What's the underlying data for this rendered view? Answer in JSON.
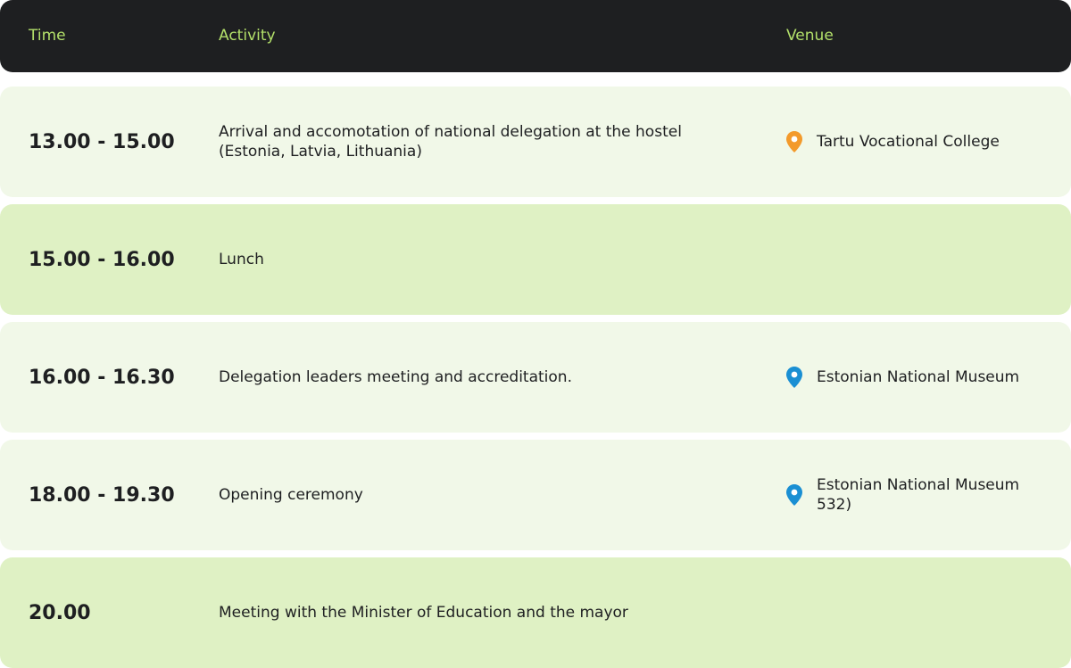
{
  "header": {
    "time": "Time",
    "activity": "Activity",
    "venue": "Venue"
  },
  "colors": {
    "header_bg": "#1e1f21",
    "header_text": "#b3e06a",
    "row_light": "#f1f8e8",
    "row_dark": "#dff1c4",
    "pin_orange": "#f39a2b",
    "pin_blue": "#1a8fd3"
  },
  "rows": [
    {
      "time": "13.00 - 15.00",
      "activity": "Arrival and accomotation of national delegation at the hostel (Estonia, Latvia, Lithuania)",
      "venue": "Tartu Vocational College",
      "pin_icon": "location-pin-icon-orange"
    },
    {
      "time": "15.00 - 16.00",
      "activity": "Lunch",
      "venue": ""
    },
    {
      "time": "16.00 - 16.30",
      "activity": "Delegation leaders meeting and accreditation.",
      "venue": "Estonian National Museum",
      "pin_icon": "location-pin-icon-blue"
    },
    {
      "time": "18.00 - 19.30",
      "activity": "Opening ceremony",
      "venue": "Estonian National Museum 532)",
      "pin_icon": "location-pin-icon-blue"
    },
    {
      "time": "20.00",
      "activity": "Meeting with the Minister of Education and the mayor",
      "venue": ""
    }
  ]
}
